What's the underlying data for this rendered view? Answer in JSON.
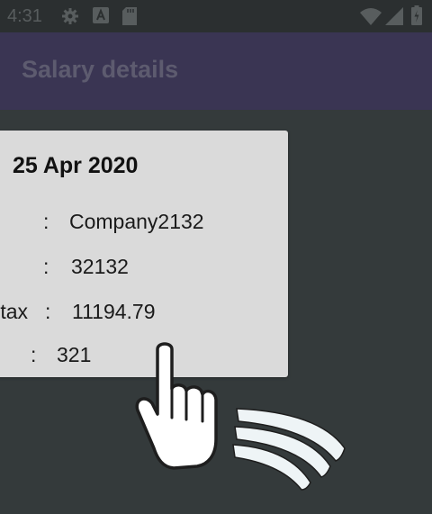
{
  "status_bar": {
    "time": "4:31",
    "left_icons": [
      "gear-icon",
      "a-box-icon",
      "sd-card-icon"
    ],
    "right_icons": [
      "wifi-icon",
      "signal-icon",
      "battery-icon"
    ]
  },
  "app_bar": {
    "title": "Salary details"
  },
  "card": {
    "date": "25 Apr 2020",
    "rows": [
      {
        "label": "",
        "colon": ":",
        "value": "Company2132"
      },
      {
        "label": "",
        "colon": ":",
        "value": "32132"
      },
      {
        "label": "tax",
        "colon": ":",
        "value": "11194.79"
      },
      {
        "label": "",
        "colon": ":",
        "value": "321"
      }
    ]
  },
  "overlay": {
    "icon": "swipe-gesture-hand-icon"
  },
  "colors": {
    "background": "#343a3b",
    "status_bar": "#2b2f30",
    "app_bar": "#3a3553",
    "card": "#dadada"
  }
}
